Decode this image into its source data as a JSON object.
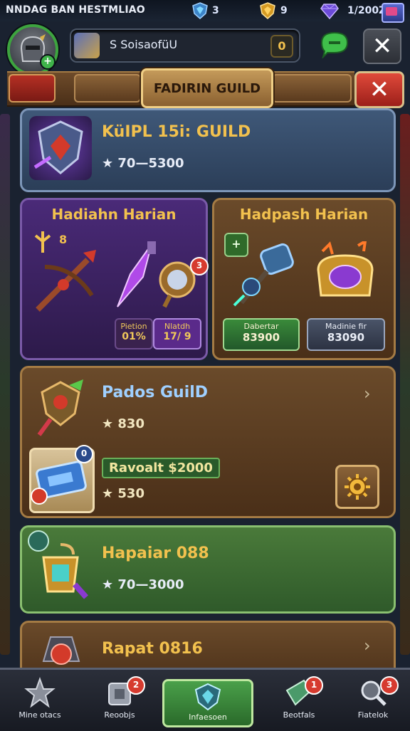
{
  "topbar": {
    "title": "NNDAG BAN HESTMLIAO",
    "resources": [
      {
        "icon": "shield-gem-icon",
        "value": "3",
        "color": "#4aa6ff"
      },
      {
        "icon": "gold-shield-icon",
        "value": "9",
        "color": "#f2b93b"
      },
      {
        "icon": "purple-gem-icon",
        "value": "1/200Z",
        "color": "#8f6bff"
      }
    ]
  },
  "header": {
    "search_text": "S SoisaofüU",
    "search_badge": "0"
  },
  "tabs": {
    "active_label": "FADIRIN GUILD"
  },
  "guild_banner": {
    "title": "KüIPL 15i: GUILD",
    "price": "★ 70—5300"
  },
  "daily_left": {
    "title": "Hadiahn Harian",
    "small_count": "8",
    "stat_label_1": "Pietion",
    "stat_value_1": "01%",
    "stat_label_2": "Nlatdh",
    "stat_value_2": "17/ 9",
    "gem_badge": "3"
  },
  "daily_right": {
    "title": "Hadpash Harian",
    "button_1_label": "Dabertar",
    "button_1_value": "83900",
    "button_2_label": "Madinie fir",
    "button_2_value": "83090"
  },
  "pados_card": {
    "title": "Pados GuilD",
    "price_1": "★ 830",
    "tag": "Ravoalt $2000",
    "price_2": "★ 530",
    "item_badge": "0"
  },
  "hapaiar_card": {
    "title": "Hapaiar 088",
    "price": "★ 70—3000"
  },
  "rapat_card": {
    "title": "Rapat 0816"
  },
  "bottom_nav": [
    {
      "label": "Mine otacs",
      "icon": "star-icon",
      "badge": ""
    },
    {
      "label": "Reoobjs",
      "icon": "crate-icon",
      "badge": "2"
    },
    {
      "label": "Infaesoen",
      "icon": "gem-shield-icon",
      "badge": ""
    },
    {
      "label": "Beotfals",
      "icon": "green-gem-icon",
      "badge": "1"
    },
    {
      "label": "Fiatelok",
      "icon": "magnifier-icon",
      "badge": "3"
    }
  ]
}
